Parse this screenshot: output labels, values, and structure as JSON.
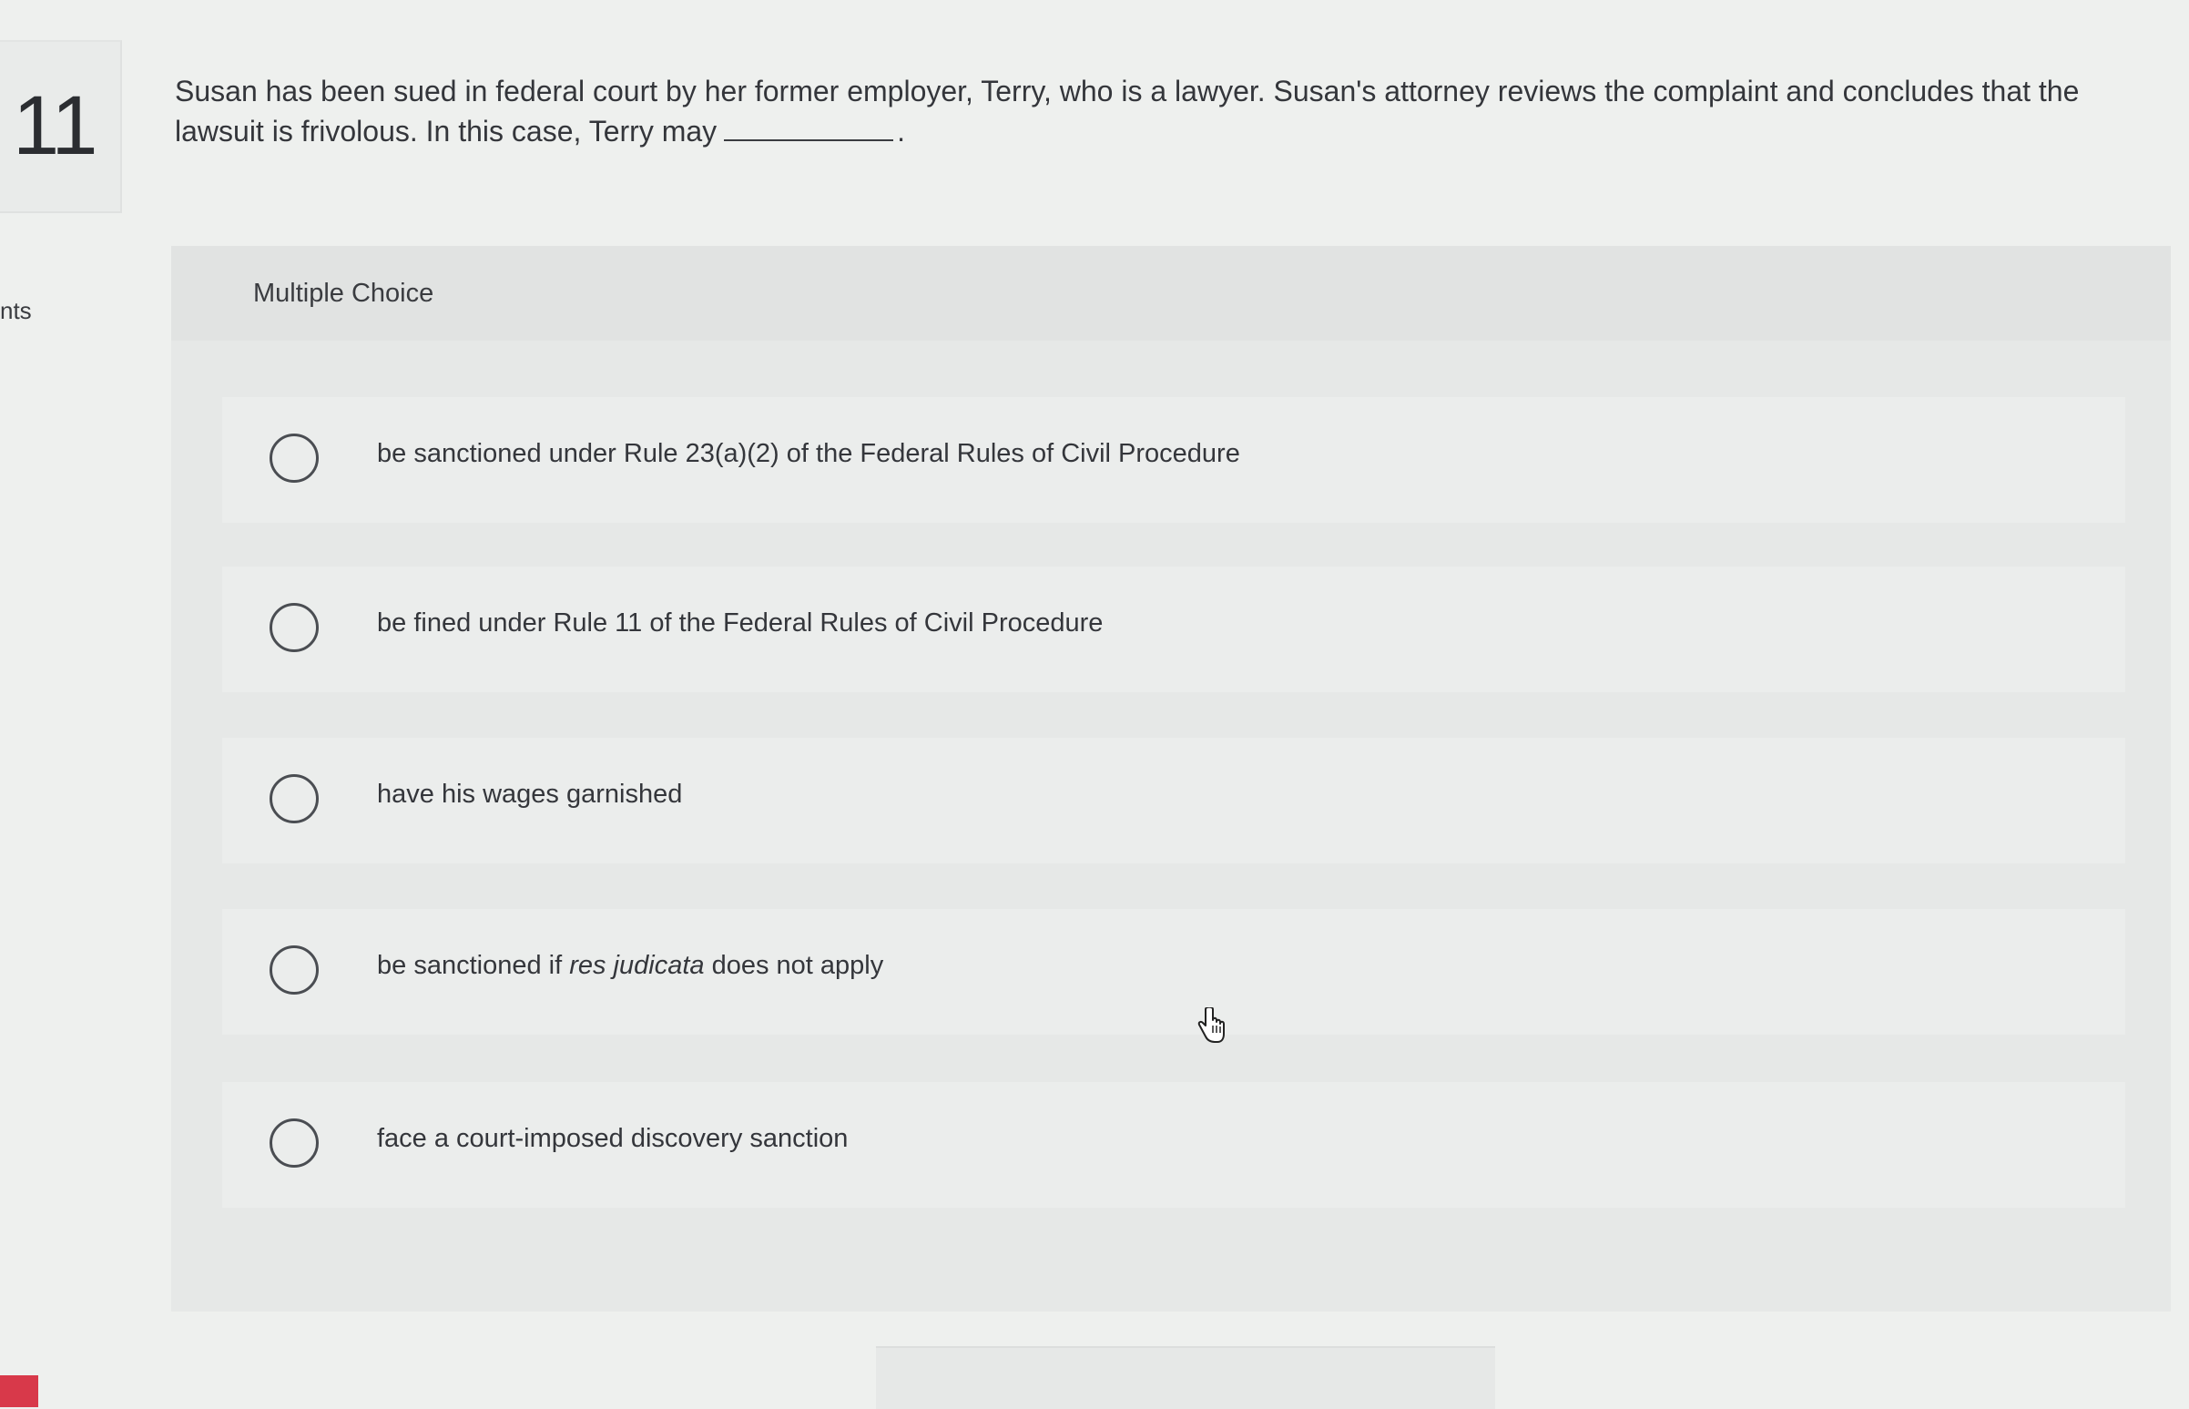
{
  "question": {
    "number": "11",
    "text_before_blank": "Susan has been sued in federal court by her former employer, Terry, who is a lawyer. Susan's attorney reviews the complaint and concludes that the lawsuit is frivolous. In this case, Terry may",
    "text_after_blank": "."
  },
  "sidebar": {
    "points_label": "nts"
  },
  "multiple_choice": {
    "header": "Multiple Choice",
    "options": [
      {
        "label": "be sanctioned under Rule 23(a)(2) of the Federal Rules of Civil Procedure"
      },
      {
        "label": "be fined under Rule 11 of the Federal Rules of Civil Procedure"
      },
      {
        "label": "have his wages garnished"
      },
      {
        "label_before": "be sanctioned if ",
        "label_italic": "res judicata",
        "label_after": " does not apply"
      },
      {
        "label": "face a court-imposed discovery sanction"
      }
    ]
  },
  "icons": {
    "cursor": "hand-pointer-icon",
    "radio": "radio-circle-icon"
  },
  "colors": {
    "background": "#eef0ee",
    "panel": "#e6e8e7",
    "text": "#34363b",
    "accent_marker": "#d8394a"
  }
}
